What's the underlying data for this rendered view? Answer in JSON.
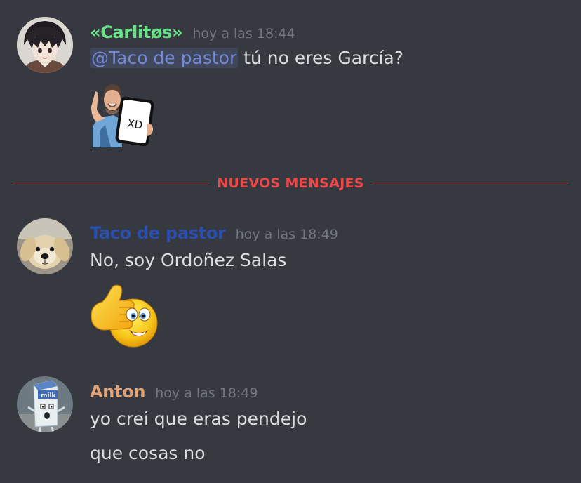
{
  "messages": [
    {
      "author": "«Carlitøs»",
      "author_color": "#69e28a",
      "timestamp": "hoy a las 18:44",
      "mention": "@Taco de pastor",
      "text": " tú no eres García?",
      "attachment": {
        "label": "XD"
      }
    },
    {
      "author": "Taco de pastor",
      "author_color": "#2a4fae",
      "timestamp": "hoy a las 18:49",
      "text": "No, soy Ordoñez Salas",
      "attachment_icon": "thumbs-up-emoji-icon"
    },
    {
      "author": "Anton",
      "author_color": "#e0a278",
      "timestamp": "hoy a las 18:49",
      "text": "yo crei que eras pendejo",
      "text2": "que cosas no",
      "avatar_label": "milk"
    }
  ],
  "divider": {
    "label": "NUEVOS MENSAJES",
    "color": "#f04747"
  },
  "colors": {
    "background": "#36393f",
    "text": "#dcddde",
    "timestamp": "#72767d",
    "mention": "#7289da"
  }
}
